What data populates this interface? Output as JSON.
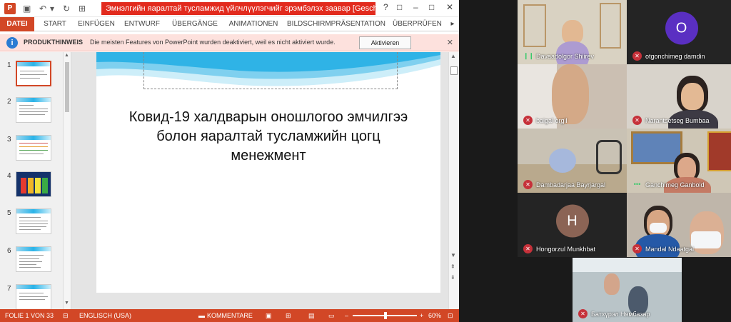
{
  "ppt": {
    "app_icon": "P",
    "doc_title": "Эмнэлгийн яаралтай тусламжид үйлчлүүлэгчийг эрэмбэлэх заавар [Geschützte A...",
    "title_icons": [
      "save-icon",
      "undo-icon",
      "redo-icon",
      "customize-icon"
    ],
    "window_controls": [
      "?",
      "□",
      "–",
      "□",
      "✕"
    ],
    "tabs": [
      "DATEI",
      "START",
      "EINFÜGEN",
      "ENTWURF",
      "ÜBERGÄNGE",
      "ANIMATIONEN",
      "BILDSCHIRMPRÄSENTATION",
      "ÜBERPRÜFEN"
    ],
    "tab_overflow": "▸",
    "notification": {
      "head": "PRODUKTHINWEIS",
      "message": "Die meisten Features von PowerPoint wurden deaktiviert, weil es nicht aktiviert wurde.",
      "button": "Aktivieren",
      "close": "✕"
    },
    "thumbnails": [
      "1",
      "2",
      "3",
      "4",
      "5",
      "6",
      "7"
    ],
    "slide_text": "Ковид-19 халдварын оношлогоо эмчилгээ болон яаралтай тусламжийн цогц  менежмент",
    "status": {
      "slide_info": "FOLIE 1 VON 33",
      "language": "ENGLISCH (USA)",
      "comments": "KOMMENTARE",
      "zoom": "60%",
      "zoom_level_percent": 60
    },
    "colors": {
      "accent": "#d24726",
      "title_red": "#e22b1e",
      "notif_bg": "#fde1dd"
    }
  },
  "participants": [
    {
      "name": "Davaadolgor Shiirev",
      "mic": "active",
      "kind": "video"
    },
    {
      "name": "otgonchimeg damdin",
      "mic": "muted",
      "kind": "avatar",
      "initial": "O",
      "color": "#5a2fc2"
    },
    {
      "name": "baigal orgil",
      "mic": "muted",
      "kind": "video"
    },
    {
      "name": "Narantsetseg Bumbaa",
      "mic": "muted",
      "kind": "video"
    },
    {
      "name": "Dambadarjaa Bayrjargal",
      "mic": "muted",
      "kind": "video"
    },
    {
      "name": "Ganchimeg Ganbold",
      "mic": "active",
      "kind": "video"
    },
    {
      "name": "Hongorzul Munkhbat",
      "mic": "muted",
      "kind": "avatar",
      "initial": "H",
      "color": "#8b6455"
    },
    {
      "name": "Mandal Ndaatgal",
      "mic": "muted",
      "kind": "video"
    },
    {
      "name": "Батхүрэл Нямбазар",
      "mic": "muted",
      "kind": "video"
    }
  ]
}
